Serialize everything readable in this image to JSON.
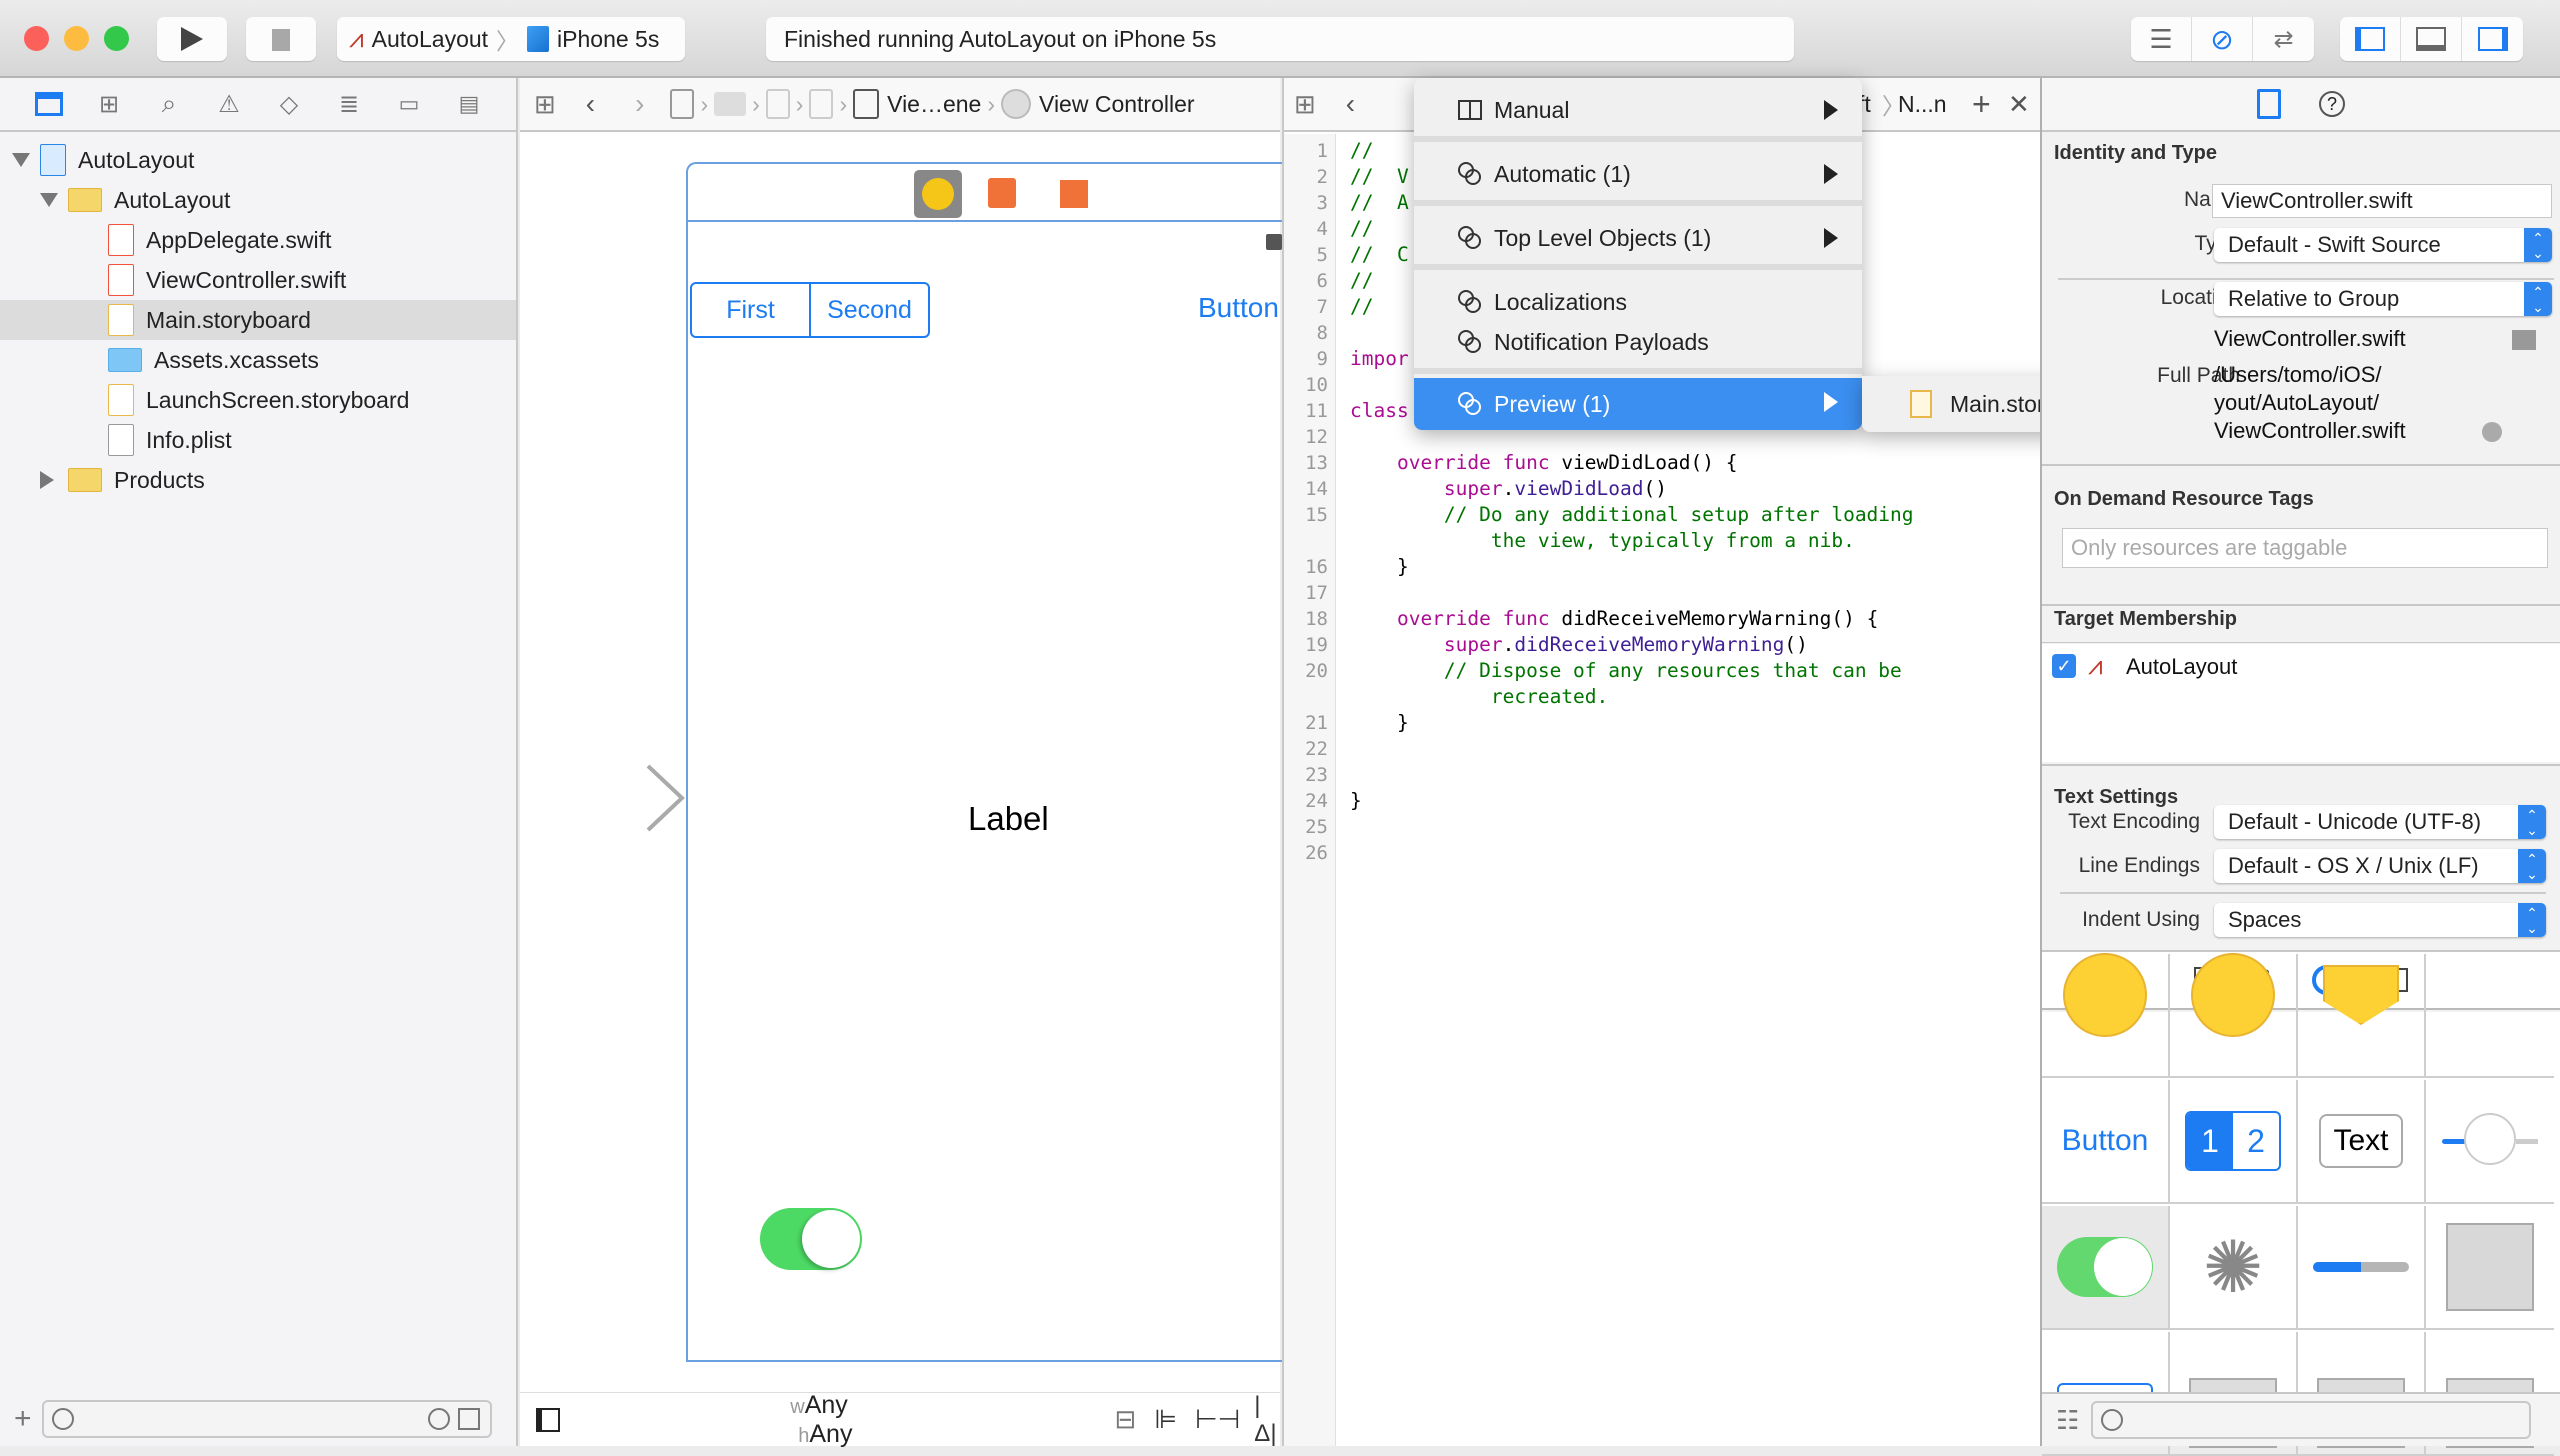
{
  "toolbar": {
    "scheme": "AutoLayout",
    "device": "iPhone 5s",
    "status": "Finished running AutoLayout on iPhone 5s",
    "colors": {
      "close": "#fc605b",
      "minimize": "#fdbc40",
      "zoom": "#34c84a",
      "accent": "#1d7cf2"
    }
  },
  "navigator": {
    "tree": [
      {
        "label": "AutoLayout",
        "level": 0,
        "kind": "project",
        "expanded": true
      },
      {
        "label": "AutoLayout",
        "level": 1,
        "kind": "group",
        "expanded": true
      },
      {
        "label": "AppDelegate.swift",
        "level": 2,
        "kind": "swift"
      },
      {
        "label": "ViewController.swift",
        "level": 2,
        "kind": "swift"
      },
      {
        "label": "Main.storyboard",
        "level": 2,
        "kind": "storyboard",
        "selected": true
      },
      {
        "label": "Assets.xcassets",
        "level": 2,
        "kind": "assets"
      },
      {
        "label": "LaunchScreen.storyboard",
        "level": 2,
        "kind": "storyboard"
      },
      {
        "label": "Info.plist",
        "level": 2,
        "kind": "plist"
      },
      {
        "label": "Products",
        "level": 1,
        "kind": "group",
        "expanded": false
      }
    ]
  },
  "ib": {
    "breadcrumb": [
      "Vie…ene",
      "View Controller"
    ],
    "segment": [
      "First",
      "Second"
    ],
    "button_label": "Button",
    "label_text": "Label",
    "switch_on": true,
    "size_class": {
      "w_prefix": "w",
      "w_value": "Any",
      "h_prefix": "h",
      "h_value": "Any"
    }
  },
  "code": {
    "jumpbar_tail": "N...n",
    "jumpbar_partial": "ft",
    "lines": [
      {
        "n": "1",
        "parts": [
          [
            "cmt",
            "//"
          ]
        ]
      },
      {
        "n": "2",
        "parts": [
          [
            "cmt",
            "//  V"
          ]
        ]
      },
      {
        "n": "3",
        "parts": [
          [
            "cmt",
            "//  A"
          ]
        ]
      },
      {
        "n": "4",
        "parts": [
          [
            "cmt",
            "//"
          ]
        ]
      },
      {
        "n": "5",
        "parts": [
          [
            "cmt",
            "//  C"
          ]
        ]
      },
      {
        "n": "6",
        "parts": [
          [
            "cmt",
            "//"
          ]
        ]
      },
      {
        "n": "7",
        "parts": [
          [
            "cmt",
            "//"
          ]
        ]
      },
      {
        "n": "8",
        "parts": []
      },
      {
        "n": "9",
        "parts": [
          [
            "kw",
            "impor"
          ]
        ]
      },
      {
        "n": "10",
        "parts": []
      },
      {
        "n": "11",
        "parts": [
          [
            "kw",
            "class"
          ]
        ]
      },
      {
        "n": "12",
        "parts": []
      },
      {
        "n": "13",
        "parts": [
          [
            "kw",
            "    override func "
          ],
          [
            "pl",
            "viewDidLoad() {"
          ]
        ]
      },
      {
        "n": "14",
        "parts": [
          [
            "kw",
            "        super"
          ],
          [
            "pl",
            "."
          ],
          [
            "fn",
            "viewDidLoad"
          ],
          [
            "pl",
            "()"
          ]
        ]
      },
      {
        "n": "15",
        "parts": [
          [
            "cmt",
            "        // Do any additional setup after loading"
          ]
        ]
      },
      {
        "n": "",
        "parts": [
          [
            "cmt",
            "            the view, typically from a nib."
          ]
        ]
      },
      {
        "n": "16",
        "parts": [
          [
            "pl",
            "    }"
          ]
        ]
      },
      {
        "n": "17",
        "parts": []
      },
      {
        "n": "18",
        "parts": [
          [
            "kw",
            "    override func "
          ],
          [
            "pl",
            "didReceiveMemoryWarning() {"
          ]
        ]
      },
      {
        "n": "19",
        "parts": [
          [
            "kw",
            "        super"
          ],
          [
            "pl",
            "."
          ],
          [
            "fn",
            "didReceiveMemoryWarning"
          ],
          [
            "pl",
            "()"
          ]
        ]
      },
      {
        "n": "20",
        "parts": [
          [
            "cmt",
            "        // Dispose of any resources that can be"
          ]
        ]
      },
      {
        "n": "",
        "parts": [
          [
            "cmt",
            "            recreated."
          ]
        ]
      },
      {
        "n": "21",
        "parts": [
          [
            "pl",
            "    }"
          ]
        ]
      },
      {
        "n": "22",
        "parts": []
      },
      {
        "n": "23",
        "parts": []
      },
      {
        "n": "24",
        "parts": [
          [
            "pl",
            "}"
          ]
        ]
      },
      {
        "n": "25",
        "parts": []
      },
      {
        "n": "26",
        "parts": []
      }
    ]
  },
  "menu": {
    "items": [
      {
        "label": "Manual",
        "icon": "split-editor-icon",
        "submenu": true
      },
      {
        "label": "Automatic (1)",
        "icon": "assistant-rings-icon",
        "submenu": true
      },
      {
        "label": "Top Level Objects (1)",
        "icon": "assistant-rings-icon",
        "submenu": true
      },
      {
        "label": "Localizations",
        "icon": "assistant-rings-icon",
        "submenu": false
      },
      {
        "label": "Notification Payloads",
        "icon": "assistant-rings-icon",
        "submenu": false
      },
      {
        "label": "Preview (1)",
        "icon": "assistant-rings-icon",
        "submenu": true,
        "highlighted": true
      }
    ],
    "submenu_item": "Main.storyboard (Preview)"
  },
  "inspector": {
    "identity": {
      "title": "Identity and Type",
      "name_label": "Name",
      "name_value": "ViewController.swift",
      "type_label": "Type",
      "type_value": "Default - Swift Source",
      "location_label": "Location",
      "location_value": "Relative to Group",
      "location_file": "ViewController.swift",
      "fullpath_label": "Full Path",
      "fullpath_lines": [
        "/Users/tomo/iOS/",
        "yout/AutoLayout/",
        "ViewController.swift"
      ]
    },
    "odr": {
      "title": "On Demand Resource Tags",
      "placeholder": "Only resources are taggable"
    },
    "target": {
      "title": "Target Membership",
      "items": [
        {
          "label": "AutoLayout",
          "checked": true
        }
      ]
    },
    "text_settings": {
      "title": "Text Settings",
      "encoding_label": "Text Encoding",
      "encoding_value": "Default - Unicode (UTF-8)",
      "endings_label": "Line Endings",
      "endings_value": "Default - OS X / Unix (LF)",
      "indent_label": "Indent Using",
      "indent_value": "Spaces"
    },
    "library": {
      "button_label": "Button",
      "segment": [
        "1",
        "2"
      ],
      "textfield": "Text",
      "progress_fraction": 0.5
    }
  }
}
